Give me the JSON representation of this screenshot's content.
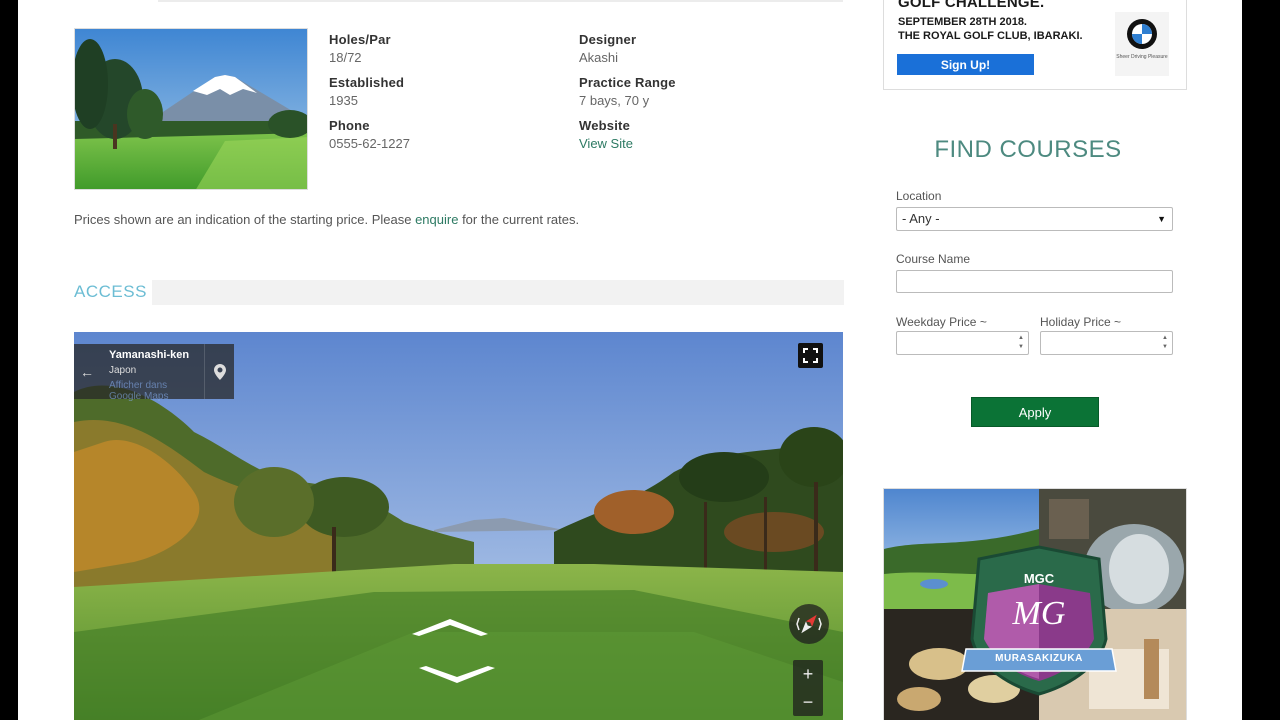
{
  "course": {
    "image_alt": "course-photo-mount-fuji",
    "holes_par_label": "Holes/Par",
    "holes_par_value": "18/72",
    "designer_label": "Designer",
    "designer_value": "Akashi",
    "established_label": "Established",
    "established_value": "1935",
    "practice_range_label": "Practice Range",
    "practice_range_value": "7 bays, 70 y",
    "phone_label": "Phone",
    "phone_value": "0555-62-1227",
    "website_label": "Website",
    "website_link": "View Site"
  },
  "price_note": {
    "before": "Prices shown are an indication of the starting price. Please ",
    "link": "enquire",
    "after": " for the current rates."
  },
  "access": {
    "title": "ACCESS"
  },
  "streetview": {
    "location_title": "Yamanashi-ken",
    "location_country": "Japon",
    "link_line1": "Afficher dans",
    "link_line2": "Google Maps",
    "zoom_in": "+",
    "zoom_out": "−"
  },
  "ad": {
    "headline": "GOLF CHALLENGE.",
    "line1": "SEPTEMBER 28TH 2018.",
    "line2": "THE ROYAL GOLF CLUB, IBARAKI.",
    "signup": "Sign Up!",
    "brand_tagline": "Sheer Driving Pleasure"
  },
  "find_courses": {
    "title": "FIND COURSES",
    "location_label": "Location",
    "location_value": "- Any -",
    "course_name_label": "Course Name",
    "course_name_value": "",
    "weekday_label": "Weekday Price ~",
    "holiday_label": "Holiday Price ~",
    "apply": "Apply"
  },
  "mgc_ad": {
    "badge_top": "MGC",
    "badge_monogram": "MG",
    "badge_banner": "MURASAKIZUKA"
  },
  "colors": {
    "link": "#2d7a63",
    "access": "#6cbdd4",
    "find_title": "#4d8a80",
    "apply": "#0b7336",
    "signup": "#1a70d8"
  }
}
